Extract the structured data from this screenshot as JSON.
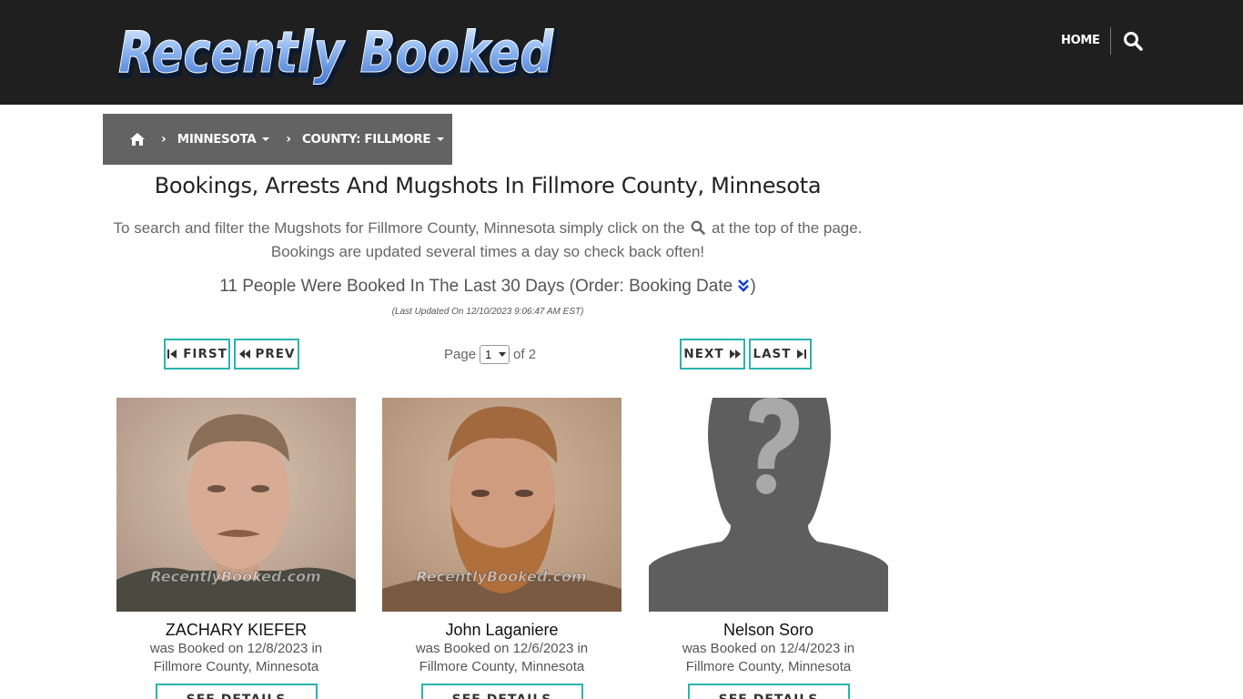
{
  "header": {
    "logo_text": "Recently Booked",
    "nav_home": "HOME",
    "search_icon": "search-icon"
  },
  "breadcrumb": {
    "home_icon": "home-icon",
    "state": "MINNESOTA",
    "county": "COUNTY: FILLMORE"
  },
  "main": {
    "title": "Bookings, Arrests And Mugshots In Fillmore County, Minnesota",
    "intro_part1": "To search and filter the Mugshots for Fillmore County, Minnesota simply click on the",
    "intro_part2": "at the top of the page.",
    "intro_line2": "Bookings are updated several times a day so check back often!",
    "count_text": "11 People Were Booked In The Last 30 Days (Order: Booking Date",
    "count_close": ")",
    "last_updated": "(Last Updated On 12/10/2023 9:06:47 AM EST)"
  },
  "pagination": {
    "first": "FIRST",
    "prev": "PREV",
    "next": "NEXT",
    "last": "LAST",
    "page_label": "Page",
    "current_page": "1",
    "of_label": "of 2"
  },
  "cards": [
    {
      "name": "ZACHARY KIEFER",
      "line1": "was Booked on 12/8/2023 in",
      "line2": "Fillmore County, Minnesota",
      "button": "SEE DETAILS",
      "watermark": "RecentlyBooked.com"
    },
    {
      "name": "John Laganiere",
      "line1": "was Booked on 12/6/2023 in",
      "line2": "Fillmore County, Minnesota",
      "button": "SEE DETAILS",
      "watermark": "RecentlyBooked.com"
    },
    {
      "name": "Nelson Soro",
      "line1": "was Booked on 12/4/2023 in",
      "line2": "Fillmore County, Minnesota",
      "button": "SEE DETAILS"
    }
  ],
  "colors": {
    "header_bg": "#1f1f1f",
    "breadcrumb_bg": "#636363",
    "accent_teal": "#2bb3b0",
    "logo_blue": "#6a9fe8"
  }
}
